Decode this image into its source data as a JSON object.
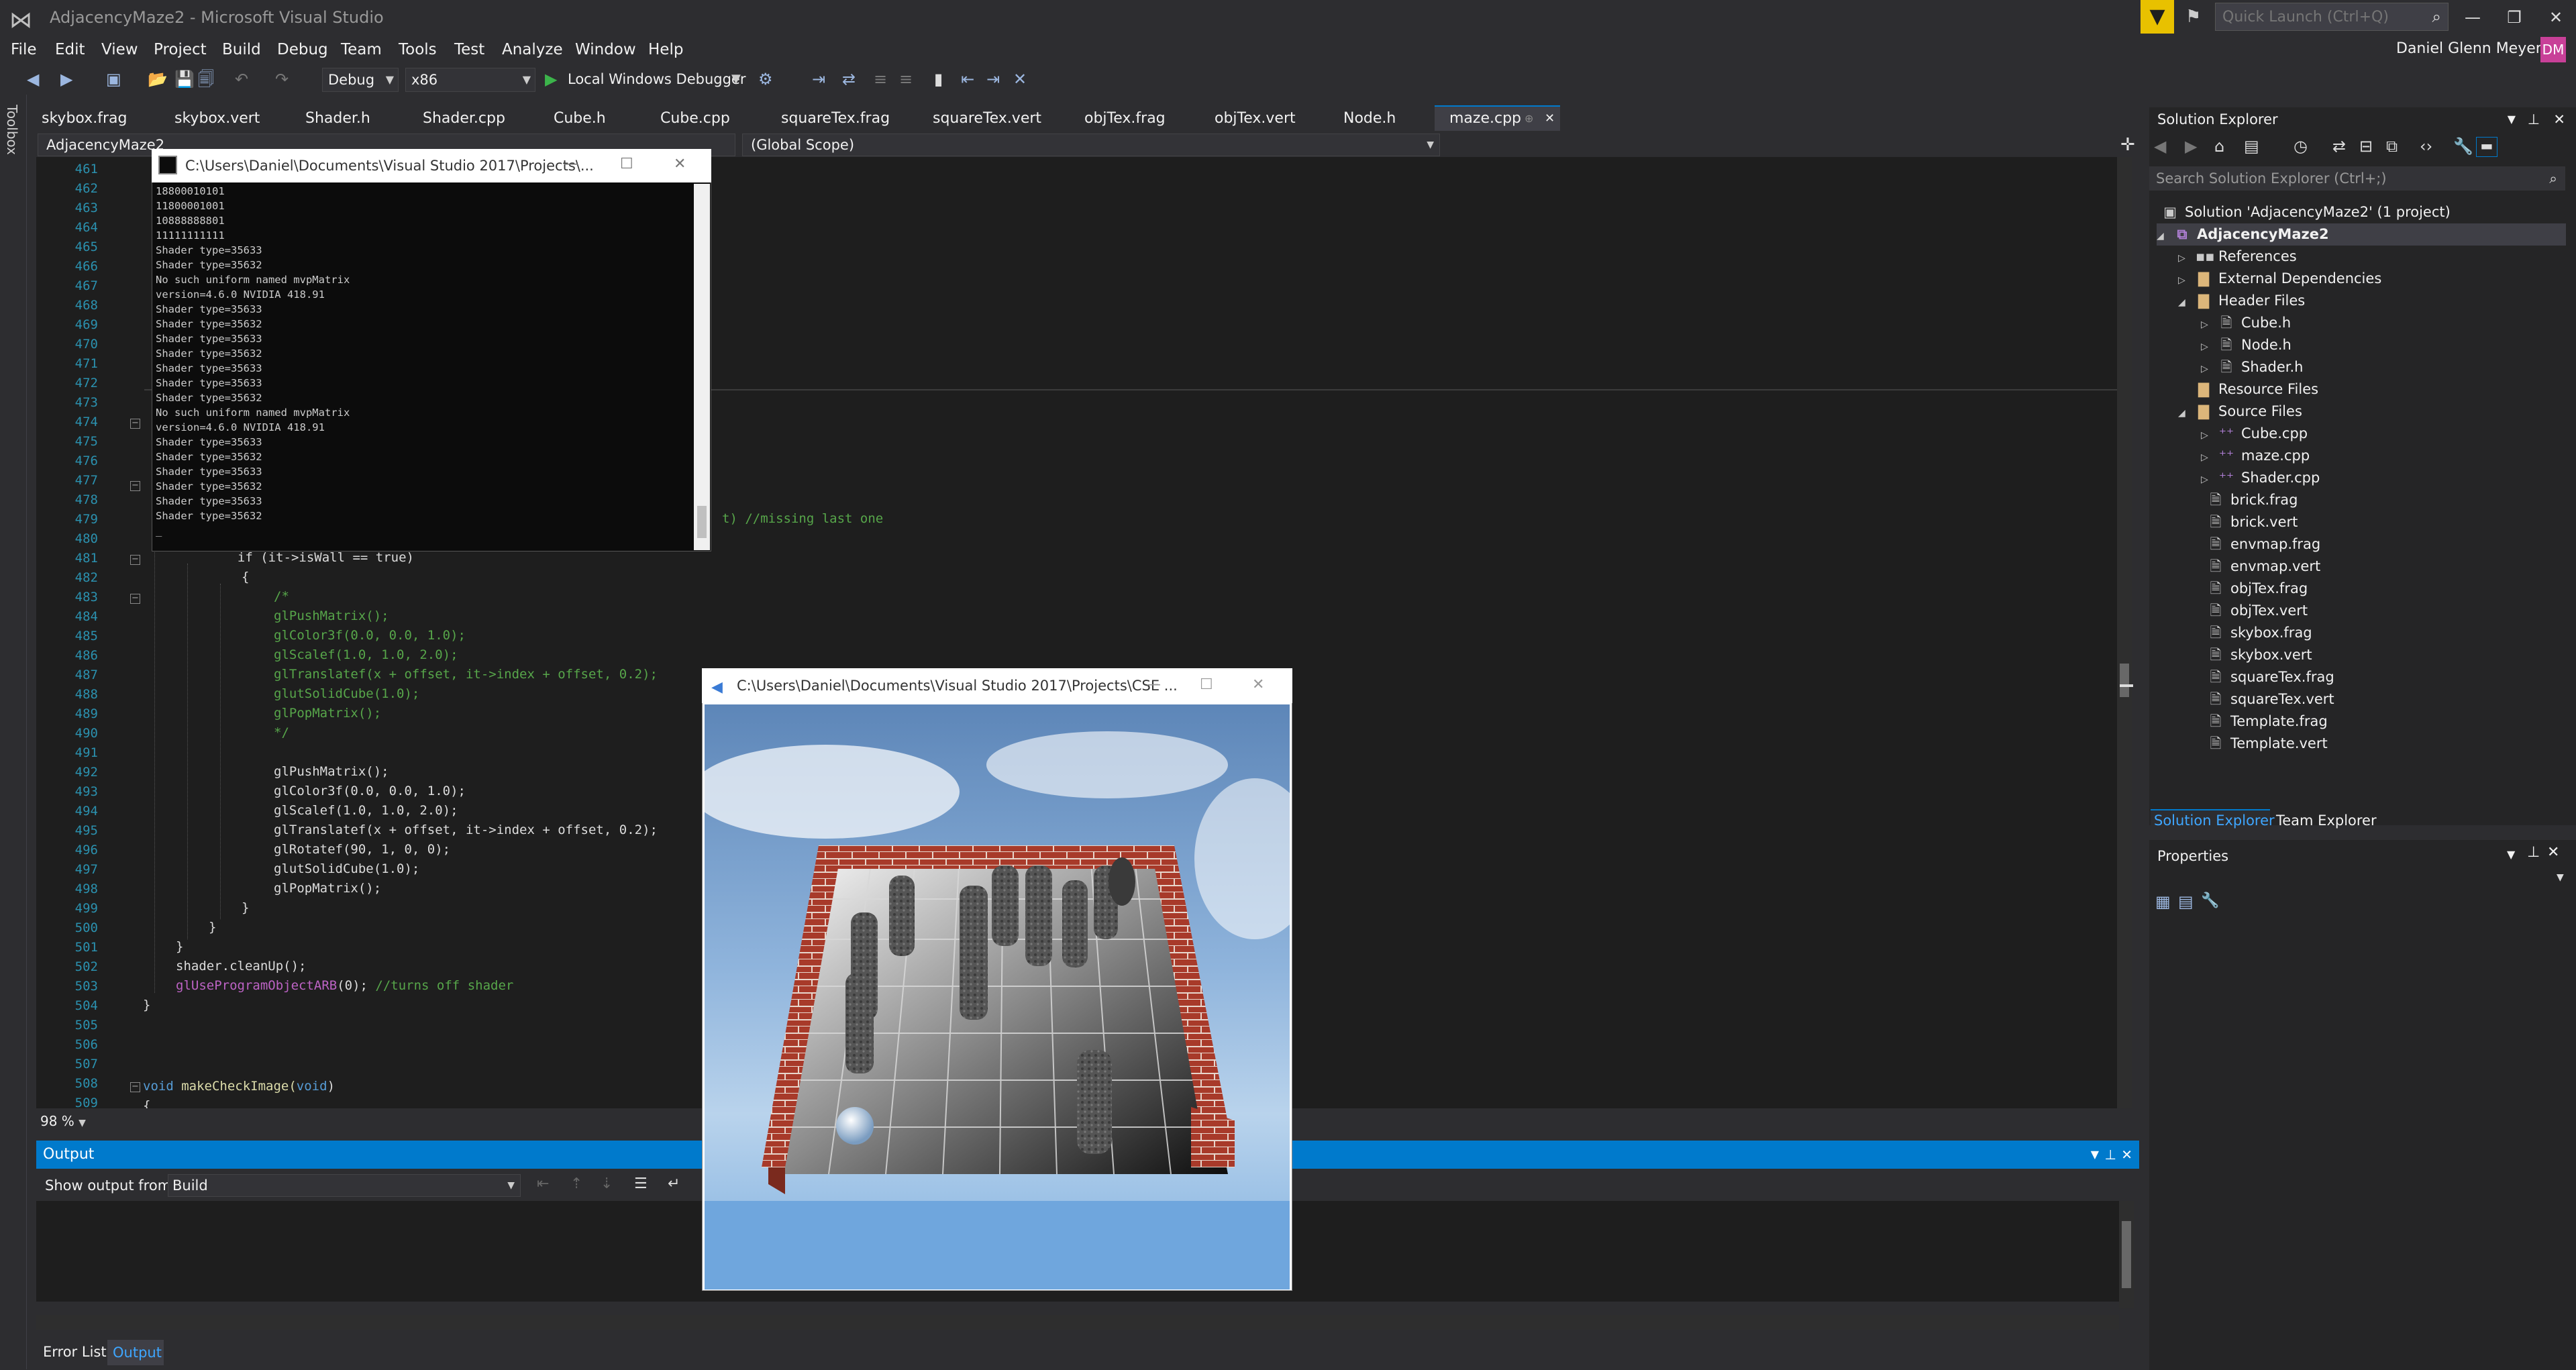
{
  "window": {
    "title": "AdjacencyMaze2 - Microsoft Visual Studio",
    "quick_launch_placeholder": "Quick Launch (Ctrl+Q)",
    "user_name": "Daniel Glenn Meyer",
    "user_initials": "DM"
  },
  "menu": [
    "File",
    "Edit",
    "View",
    "Project",
    "Build",
    "Debug",
    "Team",
    "Tools",
    "Test",
    "Analyze",
    "Window",
    "Help"
  ],
  "toolbar": {
    "configuration": "Debug",
    "platform": "x86",
    "debugger_label": "Local Windows Debugger"
  },
  "toolbox_label": "Toolbox",
  "tabs": [
    "skybox.frag",
    "skybox.vert",
    "Shader.h",
    "Shader.cpp",
    "Cube.h",
    "Cube.cpp",
    "squareTex.frag",
    "squareTex.vert",
    "objTex.frag",
    "objTex.vert",
    "Node.h",
    "maze.cpp"
  ],
  "active_tab": "maze.cpp",
  "nav": {
    "project": "AdjacencyMaze2",
    "scope": "(Global Scope)"
  },
  "code": {
    "line_numbers": [
      "461",
      "462",
      "463",
      "464",
      "465",
      "466",
      "467",
      "468",
      "469",
      "470",
      "471",
      "472",
      "473",
      "474",
      "475",
      "476",
      "477",
      "478",
      "479",
      "480",
      "481",
      "482",
      "483",
      "484",
      "485",
      "486",
      "487",
      "488",
      "489",
      "490",
      "491",
      "492",
      "493",
      "494",
      "495",
      "496",
      "497",
      "498",
      "499",
      "500",
      "501",
      "502",
      "503",
      "504",
      "505",
      "506",
      "507",
      "508",
      "509"
    ],
    "partial_479": "t) //missing last one",
    "l481": "if (it->isWall == true)",
    "l482": "{",
    "l483": "/*",
    "l484": "glPushMatrix();",
    "l485": "glColor3f(0.0, 0.0, 1.0);",
    "l486": "glScalef(1.0, 1.0, 2.0);",
    "l487": "glTranslatef(x + offset, it->index + offset, 0.2);",
    "l488": "glutSolidCube(1.0);",
    "l489": "glPopMatrix();",
    "l490": "*/",
    "l492": "glPushMatrix();",
    "l493": "glColor3f(0.0, 0.0, 1.0);",
    "l494": "glScalef(1.0, 1.0, 2.0);",
    "l495": "glTranslatef(x + offset, it->index + offset, 0.2);",
    "l496": "glRotatef(90, 1, 0, 0);",
    "l497": "glutSolidCube(1.0);",
    "l498": "glPopMatrix();",
    "l499": "}",
    "l500": "}",
    "l501": "}",
    "l502": "shader.cleanUp();",
    "l503_fn": "glUseProgramObjectARB",
    "l503_rest": "(0); ",
    "l503_cm": "//turns off shader",
    "l504": "}",
    "l508_kw": "void",
    "l508_fn": " makeCheckImage(",
    "l508_kw2": "void",
    "l508_end": ")",
    "l509": "{"
  },
  "zoom": "98 %",
  "output": {
    "title": "Output",
    "show_from_label": "Show output from:",
    "source": "Build"
  },
  "bottom_tabs": {
    "error_list": "Error List",
    "output": "Output"
  },
  "solution_explorer": {
    "title": "Solution Explorer",
    "search_placeholder": "Search Solution Explorer (Ctrl+;)",
    "solution": "Solution 'AdjacencyMaze2' (1 project)",
    "project": "AdjacencyMaze2",
    "references": "References",
    "external_deps": "External Dependencies",
    "header_files": "Header Files",
    "headers": [
      "Cube.h",
      "Node.h",
      "Shader.h"
    ],
    "resource_files": "Resource Files",
    "source_files": "Source Files",
    "sources": [
      "Cube.cpp",
      "maze.cpp",
      "Shader.cpp"
    ],
    "files": [
      "brick.frag",
      "brick.vert",
      "envmap.frag",
      "envmap.vert",
      "objTex.frag",
      "objTex.vert",
      "skybox.frag",
      "skybox.vert",
      "squareTex.frag",
      "squareTex.vert",
      "Template.frag",
      "Template.vert"
    ],
    "tab_solution_explorer": "Solution Explorer",
    "tab_team_explorer": "Team Explorer"
  },
  "properties": {
    "title": "Properties"
  },
  "console": {
    "title": "C:\\Users\\Daniel\\Documents\\Visual Studio 2017\\Projects\\...",
    "lines": [
      "18800010101",
      "11800001001",
      "10888888801",
      "11111111111",
      "Shader type=35633",
      "Shader type=35632",
      "No such uniform named mvpMatrix",
      "version=4.6.0 NVIDIA 418.91",
      "Shader type=35633",
      "Shader type=35632",
      "Shader type=35633",
      "Shader type=35632",
      "Shader type=35633",
      "Shader type=35633",
      "Shader type=35632",
      "No such uniform named mvpMatrix",
      "version=4.6.0 NVIDIA 418.91",
      "Shader type=35633",
      "Shader type=35632",
      "Shader type=35633",
      "Shader type=35632",
      "Shader type=35633",
      "Shader type=35632",
      "_"
    ]
  },
  "gl_window": {
    "title": "C:\\Users\\Daniel\\Documents\\Visual Studio 2017\\Projects\\CSE ..."
  },
  "colors": {
    "accent": "#007acc",
    "bg": "#2d2d30",
    "editor": "#1e1e1e",
    "filter": "#e8c100",
    "avatar": "#c84098",
    "brick": "#a83a2a"
  }
}
